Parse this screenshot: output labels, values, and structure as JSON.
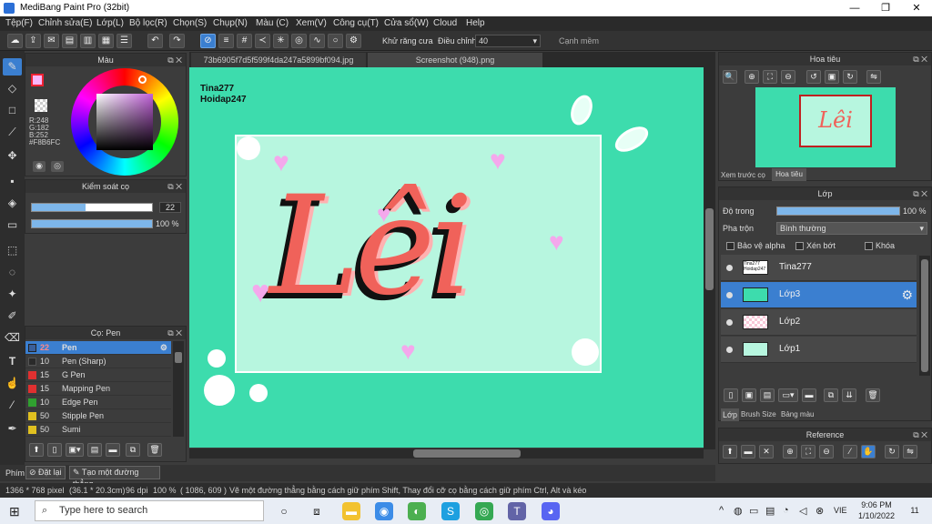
{
  "window": {
    "title": "MediBang Paint Pro (32bit)",
    "min": "—",
    "max": "❐",
    "close": "✕"
  },
  "menu": [
    "Tệp(F)",
    "Chỉnh sửa(E)",
    "Lớp(L)",
    "Bộ lọc(R)",
    "Chọn(S)",
    "Chụp(N)",
    "Màu (C)",
    "Xem(V)",
    "Công cụ(T)",
    "Cửa sổ(W)",
    "Cloud",
    "Help"
  ],
  "toolbar": {
    "antialias_label": "Khử răng cưa",
    "adjust_label": "Điều chỉnh",
    "adjust_value": "40",
    "edge_label": "Cạnh mềm",
    "antialias_checked": "✕",
    "edge_checked": "✕"
  },
  "color_panel": {
    "title": "Màu",
    "r": "R:248",
    "g": "G:182",
    "b": "B:252",
    "hex": "#F8B6FC",
    "primary_color": "#F8B6FC"
  },
  "brush_control": {
    "title": "Kiểm soát cọ",
    "size": "22",
    "opacity": "100 %",
    "size_fraction": 0.45,
    "opacity_fraction": 1.0
  },
  "brush_panel": {
    "title": "Cọ: Pen",
    "items": [
      {
        "size": "22",
        "name": "Pen",
        "color": "#3a5f9a"
      },
      {
        "size": "10",
        "name": "Pen (Sharp)",
        "color": "#2a2a2a"
      },
      {
        "size": "15",
        "name": "G Pen",
        "color": "#e03030"
      },
      {
        "size": "15",
        "name": "Mapping Pen",
        "color": "#e03030"
      },
      {
        "size": "10",
        "name": "Edge Pen",
        "color": "#30a030"
      },
      {
        "size": "50",
        "name": "Stipple Pen",
        "color": "#e0c020"
      },
      {
        "size": "50",
        "name": "Sumi",
        "color": "#e0c020"
      }
    ]
  },
  "tabs": [
    "73b6905f7d5f599f4da247a5899bf094.jpg",
    "Screenshot (948).png"
  ],
  "canvas": {
    "watermark_line1": "Tina277",
    "watermark_line2": "Hoidap247",
    "art_text": "Lêi"
  },
  "bottom": {
    "panel_label": "Phím",
    "reset": "Đặt lại",
    "new_line": "Tạo một đường thẳng"
  },
  "status": {
    "size": "1366 * 768 pixel",
    "cm": "(36.1 * 20.3cm)",
    "dpi": "96 dpi",
    "zoom": "100 %",
    "coords": "( 1086, 609 )",
    "hint": "Vẽ một đường thẳng bằng cách giữ phím Shift, Thay đổi cỡ cọ bằng cách giữ phím Ctrl, Alt và kéo"
  },
  "navigator": {
    "title": "Hoa tiêu",
    "tab_preview": "Xem trước cọ",
    "tab_nav": "Hoa tiêu"
  },
  "layers": {
    "title": "Lớp",
    "opacity_label": "Độ trong",
    "opacity_value": "100 %",
    "blend_label": "Pha trộn",
    "blend_value": "Bình thường",
    "protect_alpha": "Bảo vệ alpha",
    "clip": "Xén bớt",
    "lock": "Khóa",
    "rows": [
      {
        "name": "Tina277",
        "thumb": "Tina277 Hoidap247"
      },
      {
        "name": "Lớp3"
      },
      {
        "name": "Lớp2"
      },
      {
        "name": "Lớp1"
      }
    ],
    "tab_layer": "Lớp",
    "tab_brush_size": "Brush Size",
    "tab_palette": "Bảng màu"
  },
  "reference": {
    "title": "Reference"
  },
  "taskbar": {
    "search_placeholder": "Type here to search",
    "time": "9:06 PM",
    "date": "1/10/2022",
    "lang": "VIE",
    "notif": "11"
  }
}
